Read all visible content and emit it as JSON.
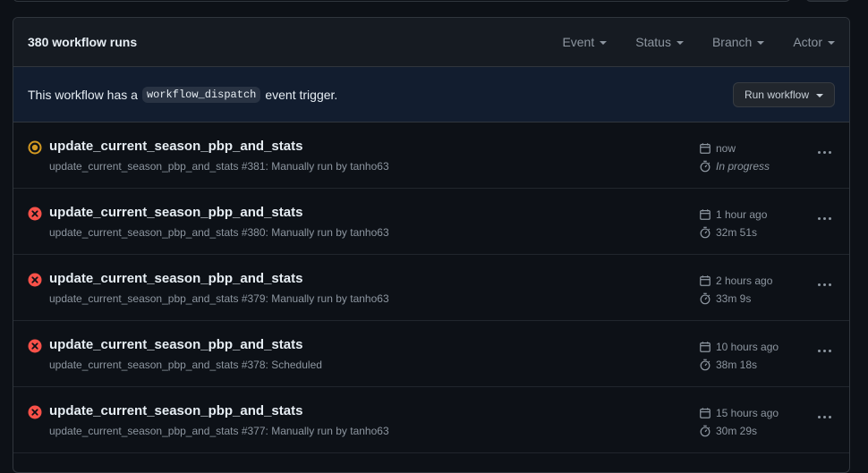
{
  "header": {
    "runs_count": "380 workflow runs",
    "filters": [
      {
        "label": "Event"
      },
      {
        "label": "Status"
      },
      {
        "label": "Branch"
      },
      {
        "label": "Actor"
      }
    ]
  },
  "dispatch": {
    "text_before": "This workflow has a",
    "code": "workflow_dispatch",
    "text_after": "event trigger.",
    "button_label": "Run workflow"
  },
  "runs": [
    {
      "title": "update_current_season_pbp_and_stats",
      "subtitle": "update_current_season_pbp_and_stats #381: Manually run by tanho63",
      "time": "now",
      "duration": "In progress",
      "status": "in-progress"
    },
    {
      "title": "update_current_season_pbp_and_stats",
      "subtitle": "update_current_season_pbp_and_stats #380: Manually run by tanho63",
      "time": "1 hour ago",
      "duration": "32m 51s",
      "status": "failure"
    },
    {
      "title": "update_current_season_pbp_and_stats",
      "subtitle": "update_current_season_pbp_and_stats #379: Manually run by tanho63",
      "time": "2 hours ago",
      "duration": "33m 9s",
      "status": "failure"
    },
    {
      "title": "update_current_season_pbp_and_stats",
      "subtitle": "update_current_season_pbp_and_stats #378: Scheduled",
      "time": "10 hours ago",
      "duration": "38m 18s",
      "status": "failure"
    },
    {
      "title": "update_current_season_pbp_and_stats",
      "subtitle": "update_current_season_pbp_and_stats #377: Manually run by tanho63",
      "time": "15 hours ago",
      "duration": "30m 29s",
      "status": "failure"
    }
  ],
  "colors": {
    "failure": "#f85149",
    "in_progress": "#d29922",
    "background": "#0d1117",
    "header_bg": "#161b22",
    "dispatch_bg": "#121d2f"
  },
  "icons": {
    "failure": "x-circle-fill-icon",
    "in_progress": "dot-fill-icon",
    "time": "calendar-icon",
    "duration": "stopwatch-icon",
    "more": "kebab-horizontal-icon"
  }
}
